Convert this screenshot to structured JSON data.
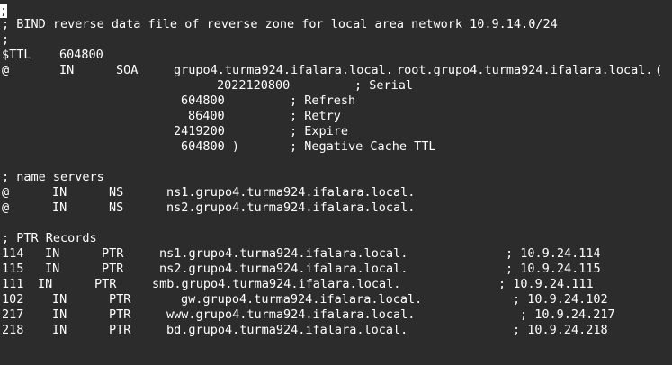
{
  "editor": {
    "cursor_char": ";",
    "lines": [
      [
        ";"
      ],
      [
        "; BIND reverse data file of reverse zone for local area network 10.9.14.0/24"
      ],
      [
        ";"
      ],
      [
        "$TTL",
        "604800"
      ],
      [
        "@",
        "IN",
        "SOA",
        "grupo4.turma924.ifalara.local.",
        "root.grupo4.turma924.ifalara.local.",
        "("
      ],
      [
        "2022120800",
        "; Serial"
      ],
      [
        "604800",
        "; Refresh"
      ],
      [
        "86400",
        "; Retry"
      ],
      [
        "2419200",
        "; Expire"
      ],
      [
        "604800 )",
        "; Negative Cache TTL"
      ],
      [],
      [
        "; name servers"
      ],
      [
        "@",
        "IN",
        "NS",
        "ns1.grupo4.turma924.ifalara.local."
      ],
      [
        "@",
        "IN",
        "NS",
        "ns2.grupo4.turma924.ifalara.local."
      ],
      [],
      [
        "; PTR Records"
      ],
      [
        "114",
        "IN",
        "PTR",
        "ns1.grupo4.turma924.ifalara.local.",
        "; 10.9.24.114"
      ],
      [
        "115",
        "IN",
        "PTR",
        "ns2.grupo4.turma924.ifalara.local.",
        "; 10.9.24.115"
      ],
      [
        "111",
        "IN",
        "PTR",
        "smb.grupo4.turma924.ifalara.local.",
        "; 10.9.24.111"
      ],
      [
        "102",
        "IN",
        "PTR",
        "gw.grupo4.turma924.ifalara.local.",
        "; 10.9.24.102"
      ],
      [
        "217",
        "IN",
        "PTR",
        "www.grupo4.turma924.ifalara.local.",
        "; 10.9.24.217"
      ],
      [
        "218",
        "IN",
        "PTR",
        "bd.grupo4.turma924.ifalara.local.",
        "; 10.9.24.218"
      ]
    ]
  }
}
